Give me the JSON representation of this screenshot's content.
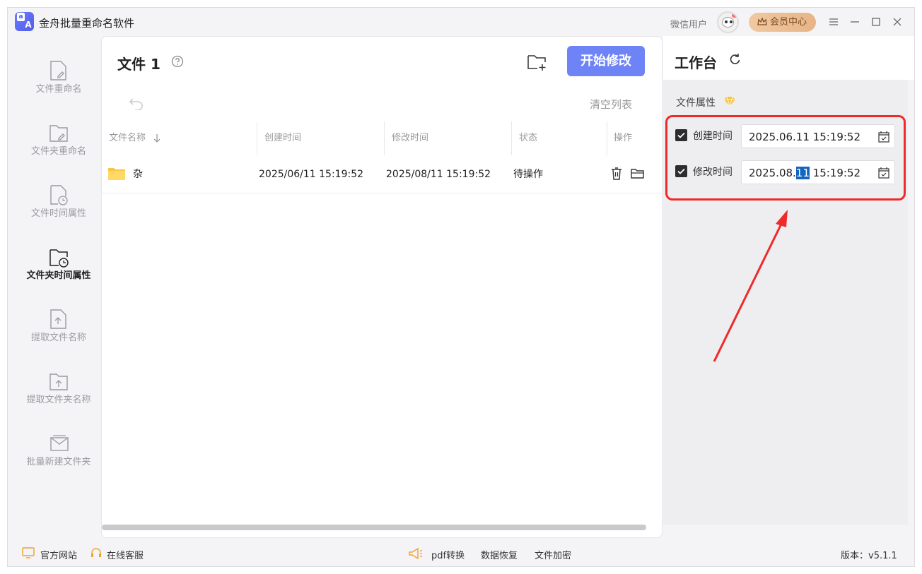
{
  "app": {
    "title": "金舟批量重命名软件",
    "user_name": "微信用户",
    "vip_label": "会员中心"
  },
  "sidebar": {
    "items": [
      {
        "label": "文件重命名",
        "icon": "file-edit-icon",
        "active": false
      },
      {
        "label": "文件夹重命名",
        "icon": "folder-edit-icon",
        "active": false
      },
      {
        "label": "文件时间属性",
        "icon": "file-clock-icon",
        "active": false
      },
      {
        "label": "文件夹时间属性",
        "icon": "folder-clock-icon",
        "active": true
      },
      {
        "label": "提取文件名称",
        "icon": "file-upload-icon",
        "active": false
      },
      {
        "label": "提取文件夹名称",
        "icon": "folder-upload-icon",
        "active": false
      },
      {
        "label": "批量新建文件夹",
        "icon": "folder-stack-icon",
        "active": false
      }
    ]
  },
  "main": {
    "title": "文件 1",
    "start_button": "开始修改",
    "clear_button": "清空列表",
    "columns": [
      "文件名称",
      "创建时间",
      "修改时间",
      "状态",
      "操作"
    ],
    "rows": [
      {
        "name": "杂",
        "created": "2025/06/11 15:19:52",
        "modified": "2025/08/11 15:19:52",
        "status": "待操作"
      }
    ]
  },
  "workbench": {
    "title": "工作台",
    "section_label": "文件属性",
    "fields": [
      {
        "label": "创建时间",
        "checked": true,
        "value": "2025.06.11 15:19:52"
      },
      {
        "label": "修改时间",
        "checked": true,
        "value_prefix": "2025.08.",
        "value_selected": "11",
        "value_suffix": " 15:19:52"
      }
    ]
  },
  "statusbar": {
    "website": "官方网站",
    "support": "在线客服",
    "pdf": "pdf转换",
    "recovery": "数据恢复",
    "encrypt": "文件加密",
    "version": "版本：v5.1.1"
  },
  "colors": {
    "accent": "#6e83f6",
    "highlight": "#ee2a2a",
    "selection": "#1565c0",
    "vip": "#e7b487"
  }
}
